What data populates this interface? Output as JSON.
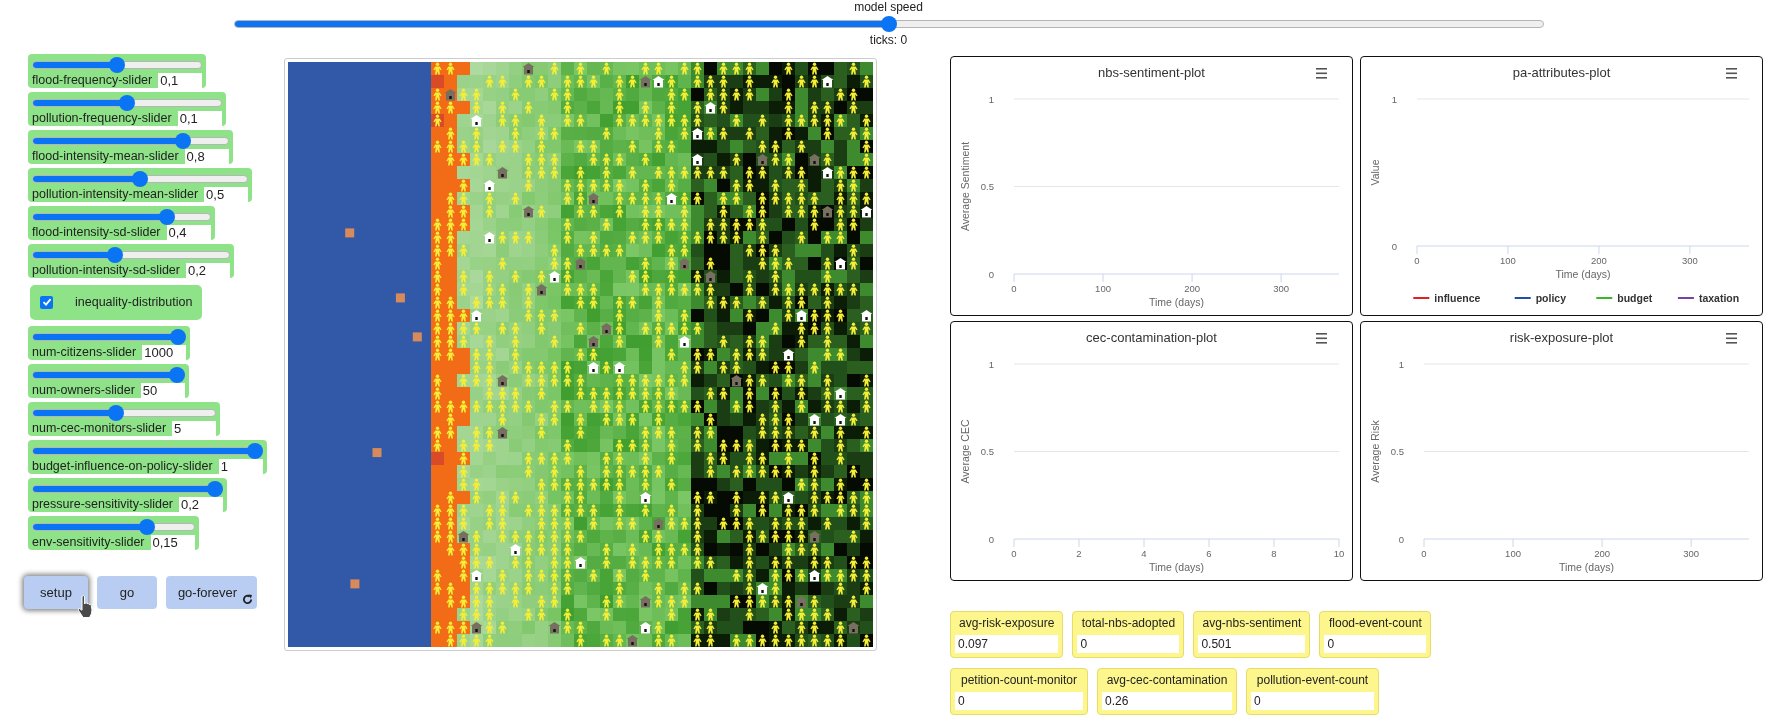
{
  "speed_slider": {
    "label": "model speed",
    "level": 0.5
  },
  "ticks": "ticks: 0",
  "controls": [
    {
      "kind": "slider",
      "label": "flood-frequency-slider",
      "value": "0,1",
      "level": 0.5
    },
    {
      "kind": "slider",
      "label": "pollution-frequency-slider",
      "value": "0,1",
      "level": 0.5
    },
    {
      "kind": "slider",
      "label": "flood-intensity-mean-slider",
      "value": "0,8",
      "level": 0.79
    },
    {
      "kind": "slider",
      "label": "pollution-intensity-mean-slider",
      "value": "0,5",
      "level": 0.5
    },
    {
      "kind": "slider",
      "label": "flood-intensity-sd-slider",
      "value": "0,4",
      "level": 0.78
    },
    {
      "kind": "slider",
      "label": "pollution-intensity-sd-slider",
      "value": "0,2",
      "level": 0.41
    },
    {
      "kind": "switch",
      "label": "inequality-distribution",
      "checked": true
    },
    {
      "kind": "slider",
      "label": "num-citizens-slider",
      "value": "1000",
      "level": 1
    },
    {
      "kind": "slider",
      "label": "num-owners-slider",
      "value": "50",
      "level": 1
    },
    {
      "kind": "slider",
      "label": "num-cec-monitors-slider",
      "value": "5",
      "level": 0.45
    },
    {
      "kind": "slider",
      "label": "budget-influence-on-policy-slider",
      "value": "1",
      "level": 1
    },
    {
      "kind": "slider",
      "label": "pressure-sensitivity-slider",
      "value": "0,2",
      "level": 1
    },
    {
      "kind": "slider",
      "label": "env-sensitivity-slider",
      "value": "0,15",
      "level": 0.73
    }
  ],
  "buttons": [
    {
      "label": "setup",
      "kind": "once",
      "focused": true,
      "pointer": true
    },
    {
      "label": "go",
      "kind": "once",
      "focused": false,
      "pointer": false
    },
    {
      "label": "go-forever",
      "kind": "forever",
      "focused": false,
      "pointer": false
    }
  ],
  "plots": [
    {
      "chart_data": {
        "type": "line",
        "title": "nbs-sentiment-plot",
        "xlabel": "Time (days)",
        "ylabel": "Average Sentiment",
        "xlim": [
          0,
          365
        ],
        "ylim": [
          0,
          1
        ],
        "xticks": [
          0,
          100,
          200,
          300
        ],
        "yticks": [
          0,
          0.5,
          1
        ]
      }
    },
    {
      "chart_data": {
        "type": "line",
        "title": "pa-attributes-plot",
        "xlabel": "Time (days)",
        "ylabel": "Value",
        "xlim": [
          0,
          365
        ],
        "ylim": [
          0,
          1
        ],
        "xticks": [
          0,
          100,
          200,
          300
        ],
        "yticks": [
          0,
          1
        ]
      },
      "legend": [
        {
          "name": "influence",
          "color": "#e32020"
        },
        {
          "name": "policy",
          "color": "#1f4fa8"
        },
        {
          "name": "budget",
          "color": "#3cb628"
        },
        {
          "name": "taxation",
          "color": "#7b3fa8"
        }
      ]
    },
    {
      "chart_data": {
        "type": "line",
        "title": "cec-contamination-plot",
        "xlabel": "Time (days)",
        "ylabel": "Average CEC",
        "xlim": [
          0,
          10
        ],
        "ylim": [
          0,
          1
        ],
        "xticks": [
          0,
          2,
          4,
          6,
          8,
          10
        ],
        "yticks": [
          0,
          0.5,
          1
        ]
      }
    },
    {
      "chart_data": {
        "type": "line",
        "title": "risk-exposure-plot",
        "xlabel": "Time (days)",
        "ylabel": "Average Risk",
        "xlim": [
          0,
          365
        ],
        "ylim": [
          0,
          1
        ],
        "xticks": [
          0,
          100,
          200,
          300
        ],
        "yticks": [
          0,
          0.5,
          1
        ]
      }
    }
  ],
  "monitors": [
    {
      "label": "avg-risk-exposure",
      "value": "0.097"
    },
    {
      "label": "total-nbs-adopted",
      "value": "0"
    },
    {
      "label": "avg-nbs-sentiment",
      "value": "0.501"
    },
    {
      "label": "flood-event-count",
      "value": "0"
    },
    {
      "label": "petition-count-monitor",
      "value": "0"
    },
    {
      "label": "avg-cec-contamination",
      "value": "0.26"
    },
    {
      "label": "pollution-event-count",
      "value": "0"
    }
  ]
}
